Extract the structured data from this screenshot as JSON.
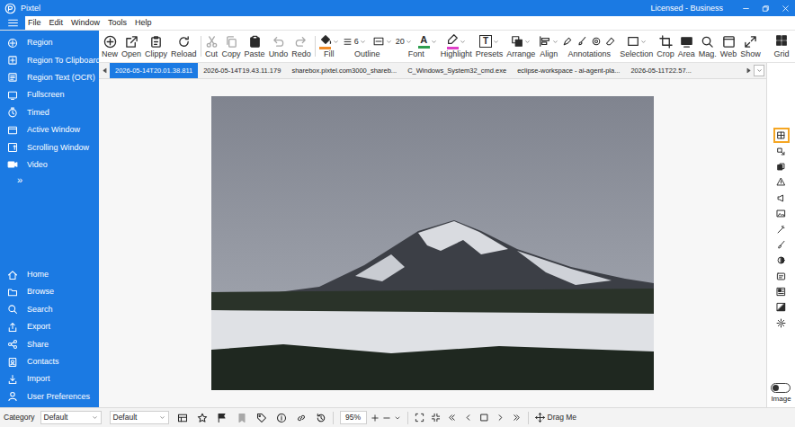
{
  "window": {
    "title": "Pixtel",
    "license": "Licensed - Business"
  },
  "menu": [
    "File",
    "Edit",
    "Window",
    "Tools",
    "Help"
  ],
  "capture": {
    "items": [
      {
        "label": "Region"
      },
      {
        "label": "Region To Clipboard"
      },
      {
        "label": "Region Text (OCR)"
      },
      {
        "label": "Fullscreen"
      },
      {
        "label": "Timed"
      },
      {
        "label": "Active Window"
      },
      {
        "label": "Scrolling Window"
      },
      {
        "label": "Video"
      }
    ],
    "more": "»"
  },
  "nav": [
    {
      "label": "Home"
    },
    {
      "label": "Browse"
    },
    {
      "label": "Search"
    },
    {
      "label": "Export"
    },
    {
      "label": "Share"
    },
    {
      "label": "Contacts"
    },
    {
      "label": "Import"
    },
    {
      "label": "User Preferences"
    }
  ],
  "toolbar": {
    "groups": [
      [
        {
          "label": "New",
          "kind": "button",
          "disabled": false
        },
        {
          "label": "Open",
          "kind": "button",
          "disabled": false
        },
        {
          "label": "Clippy",
          "kind": "button",
          "disabled": false
        },
        {
          "label": "Reload",
          "kind": "button",
          "disabled": false
        }
      ],
      [
        {
          "label": "Cut",
          "kind": "button",
          "disabled": true
        },
        {
          "label": "Copy",
          "kind": "button",
          "disabled": true
        },
        {
          "label": "Paste",
          "kind": "button",
          "disabled": false
        },
        {
          "label": "Undo",
          "kind": "button",
          "disabled": true
        },
        {
          "label": "Redo",
          "kind": "button",
          "disabled": true
        }
      ],
      [
        {
          "label": "Fill",
          "kind": "dropdown",
          "disabled": false,
          "color": "#f28c28"
        },
        {
          "label": "Outline",
          "kind": "outline",
          "disabled": false,
          "value": "6"
        },
        {
          "label": "Font",
          "kind": "font",
          "disabled": false,
          "value": "20",
          "glyph": "A",
          "color": "#2e9e4f"
        },
        {
          "label": "Highlight",
          "kind": "dropdown",
          "disabled": false,
          "color": "#e040c8"
        },
        {
          "label": "Presets",
          "kind": "dropdown",
          "disabled": false,
          "glyph": "T"
        },
        {
          "label": "Arrange",
          "kind": "dropdown",
          "disabled": false
        },
        {
          "label": "Align",
          "kind": "dropdown",
          "disabled": false
        },
        {
          "label": "Annotations",
          "kind": "multi",
          "disabled": false
        },
        {
          "label": "Selection",
          "kind": "dropdown",
          "disabled": false
        },
        {
          "label": "Crop",
          "kind": "button",
          "disabled": false
        },
        {
          "label": "Area",
          "kind": "button",
          "disabled": false
        },
        {
          "label": "Mag.",
          "kind": "button",
          "disabled": false
        },
        {
          "label": "Web",
          "kind": "button",
          "disabled": false
        },
        {
          "label": "Show",
          "kind": "button",
          "disabled": false
        }
      ]
    ],
    "grid": "Grid"
  },
  "tabs": [
    {
      "label": "2026-05-14T20.01.38.811",
      "selected": true
    },
    {
      "label": "2026-05-14T19.43.11.179",
      "selected": false
    },
    {
      "label": "sharebox.pixtel.com3000_shareb...",
      "selected": false
    },
    {
      "label": "C_Windows_System32_cmd.exe",
      "selected": false
    },
    {
      "label": "eclipse-workspace - ai-agent-pla...",
      "selected": false
    },
    {
      "label": "2026-05-11T22.57...",
      "selected": false
    }
  ],
  "side_tools": [
    {
      "selected": true
    },
    {
      "selected": false
    },
    {
      "selected": false
    },
    {
      "selected": false
    },
    {
      "selected": false
    },
    {
      "selected": false
    },
    {
      "selected": false
    },
    {
      "selected": false
    },
    {
      "selected": false
    },
    {
      "selected": false
    },
    {
      "selected": false
    },
    {
      "selected": false
    },
    {
      "selected": false
    }
  ],
  "image_toggle": {
    "label": "Image",
    "on": false
  },
  "status_bar": {
    "category_label": "Category",
    "category": "Default",
    "filter": "Default",
    "zoom": "95%",
    "drag": "Drag Me"
  }
}
